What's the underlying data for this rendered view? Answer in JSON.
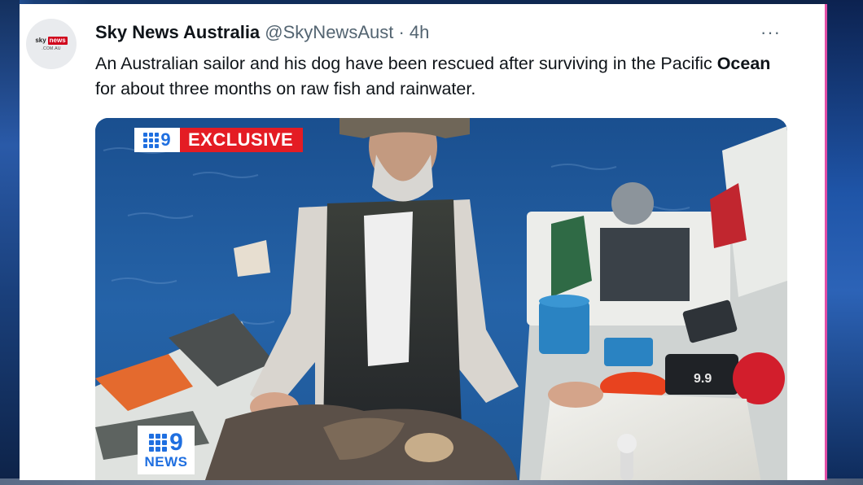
{
  "tweet": {
    "author_name": "Sky News Australia",
    "author_handle": "@SkyNewsAust",
    "separator": " · ",
    "time": "4h",
    "more_label": "···",
    "text_part1": "An Australian sailor and his dog have been rescued after surviving in the Pacific ",
    "text_bold": "Ocean",
    "text_part2": " for about three months on raw fish and rainwater."
  },
  "avatar": {
    "logo_sky": "sky",
    "logo_news": "news",
    "logo_sub": ".COM.AU"
  },
  "media": {
    "exclusive_label": "EXCLUSIVE",
    "logo_digit": "9",
    "news_word": "NEWS"
  },
  "colors": {
    "accent_red": "#e41c24",
    "nine_blue": "#1f6fe0",
    "text_primary": "#0f1419",
    "text_secondary": "#536471"
  },
  "icons": {
    "more": "more-dots-icon"
  }
}
